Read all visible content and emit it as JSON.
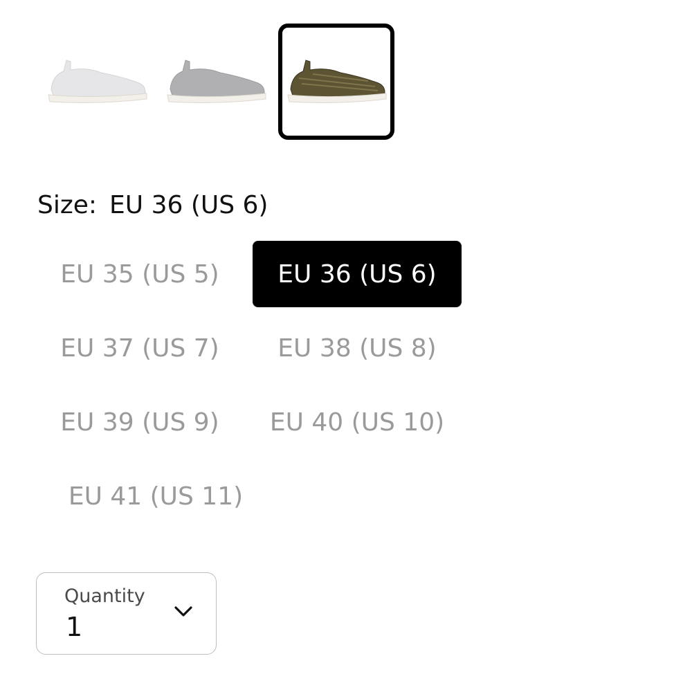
{
  "colors": {
    "accent": "#000000",
    "muted_text": "#9a9a9a",
    "border": "#bdbdbd"
  },
  "swatches": [
    {
      "name": "white-knit",
      "color": "#e8e8ea",
      "selected": false
    },
    {
      "name": "grey-knit",
      "color": "#b3b3b6",
      "selected": false
    },
    {
      "name": "olive-knit",
      "color": "#6b6038",
      "selected": true
    }
  ],
  "size": {
    "label": "Size:",
    "selected_value": "EU 36 (US 6)",
    "options": [
      {
        "label": "EU 35 (US 5)",
        "selected": false
      },
      {
        "label": "EU 36 (US 6)",
        "selected": true
      },
      {
        "label": "EU 37 (US 7)",
        "selected": false
      },
      {
        "label": "EU 38 (US 8)",
        "selected": false
      },
      {
        "label": "EU 39 (US 9)",
        "selected": false
      },
      {
        "label": "EU 40 (US 10)",
        "selected": false
      },
      {
        "label": "EU 41 (US 11)",
        "selected": false
      }
    ]
  },
  "quantity": {
    "label": "Quantity",
    "value": "1",
    "icon": "chevron-down-icon"
  }
}
